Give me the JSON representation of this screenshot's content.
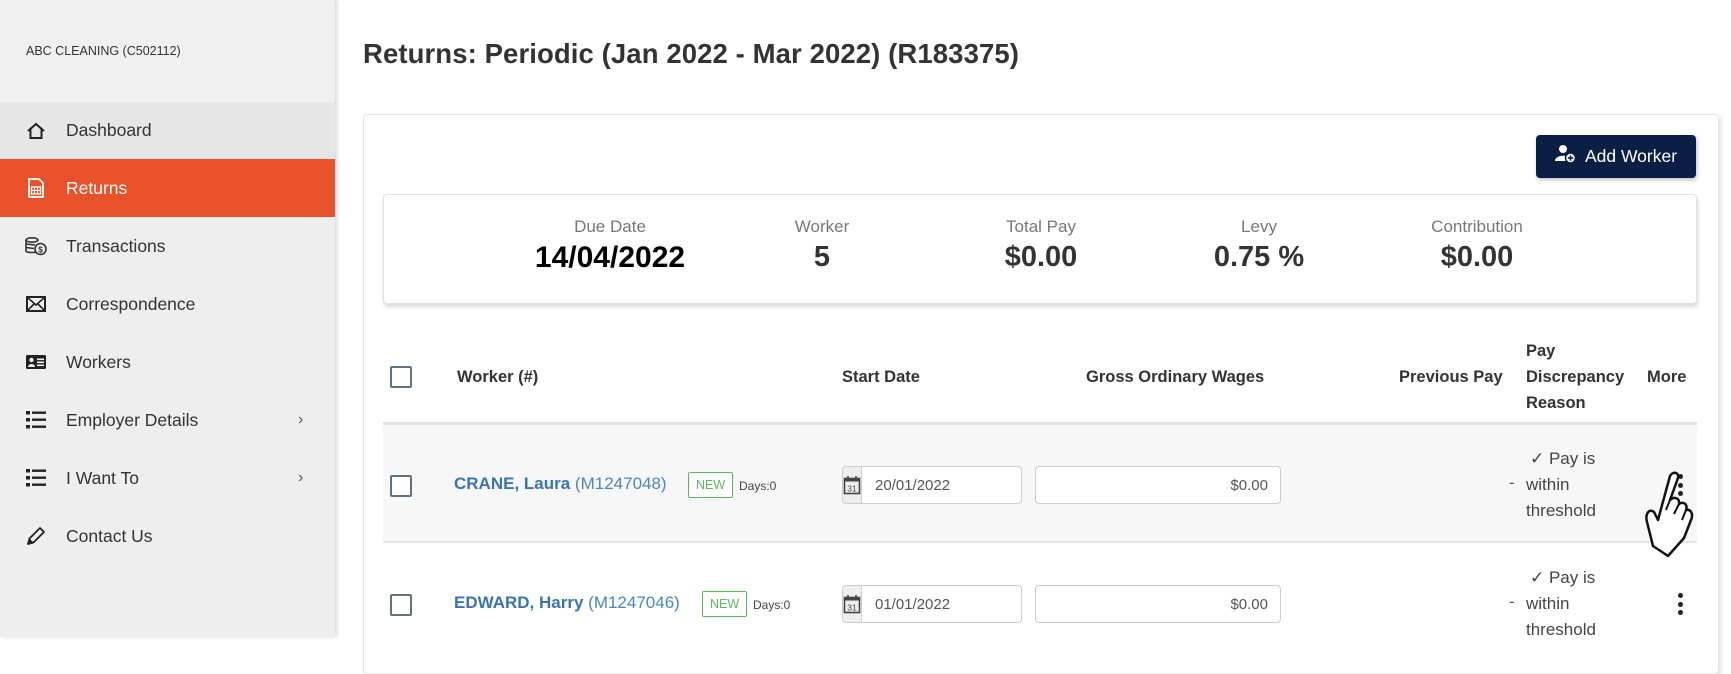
{
  "sidebar": {
    "company": "ABC CLEANING (C502112)",
    "items": [
      {
        "label": "Dashboard",
        "icon": "home-icon",
        "active": false,
        "submenu": false
      },
      {
        "label": "Returns",
        "icon": "spreadsheet-file-icon",
        "active": true,
        "submenu": false
      },
      {
        "label": "Transactions",
        "icon": "coins-dollar-icon",
        "active": false,
        "submenu": false
      },
      {
        "label": "Correspondence",
        "icon": "envelope-icon",
        "active": false,
        "submenu": false
      },
      {
        "label": "Workers",
        "icon": "id-card-icon",
        "active": false,
        "submenu": false
      },
      {
        "label": "Employer Details",
        "icon": "list-icon",
        "active": false,
        "submenu": true
      },
      {
        "label": "I Want To",
        "icon": "list-icon",
        "active": false,
        "submenu": true
      },
      {
        "label": "Contact Us",
        "icon": "pencil-icon",
        "active": false,
        "submenu": false
      }
    ],
    "chevron": "›"
  },
  "page": {
    "title": "Returns: Periodic (Jan 2022 - Mar 2022) (R183375)"
  },
  "toolbar": {
    "add_worker_label": "Add Worker"
  },
  "summary": {
    "due_date_label": "Due Date",
    "due_date": "14/04/2022",
    "worker_label": "Worker",
    "worker_count": "5",
    "total_pay_label": "Total Pay",
    "total_pay": "$0.00",
    "levy_label": "Levy",
    "levy": "0.75 %",
    "contribution_label": "Contribution",
    "contribution": "$0.00"
  },
  "table": {
    "headers": {
      "worker": "Worker (#)",
      "start_date": "Start Date",
      "gross_wages": "Gross Ordinary Wages",
      "previous_pay": "Previous Pay",
      "reason_line1": "Pay",
      "reason_line2": "Discrepancy",
      "reason_line3": "Reason",
      "more": "More"
    },
    "rows": [
      {
        "name": "CRANE, Laura",
        "id": "(M1247048)",
        "badge": "NEW",
        "days": "Days:0",
        "start_date": "20/01/2022",
        "gross_wages": "$0.00",
        "previous_pay": "-",
        "reason_line1": "✓ Pay is",
        "reason_line2": "within",
        "reason_line3": "threshold"
      },
      {
        "name": "EDWARD, Harry",
        "id": "(M1247046)",
        "badge": "NEW",
        "days": "Days:0",
        "start_date": "01/01/2022",
        "gross_wages": "$0.00",
        "previous_pay": "-",
        "reason_line1": "✓ Pay is",
        "reason_line2": "within",
        "reason_line3": "threshold"
      }
    ]
  },
  "colors": {
    "accent": "#e8522a",
    "primary_button": "#0b1f45",
    "link": "#3a74b0",
    "badge_new": "#5cb85c"
  }
}
